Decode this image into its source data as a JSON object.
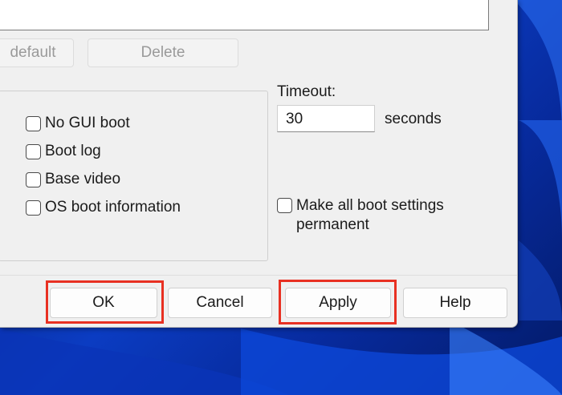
{
  "buttons": {
    "set_default": "default",
    "delete": "Delete",
    "ok": "OK",
    "cancel": "Cancel",
    "apply": "Apply",
    "help": "Help"
  },
  "boot_options": [
    {
      "label": "No GUI boot",
      "checked": false
    },
    {
      "label": "Boot log",
      "checked": false
    },
    {
      "label": "Base video",
      "checked": false
    },
    {
      "label": "OS boot information",
      "checked": false
    }
  ],
  "timeout": {
    "label": "Timeout:",
    "value": "30",
    "unit": "seconds"
  },
  "permanent": {
    "line1": "Make all boot settings",
    "line2": "permanent",
    "checked": false
  },
  "highlight_color": "#e83022"
}
